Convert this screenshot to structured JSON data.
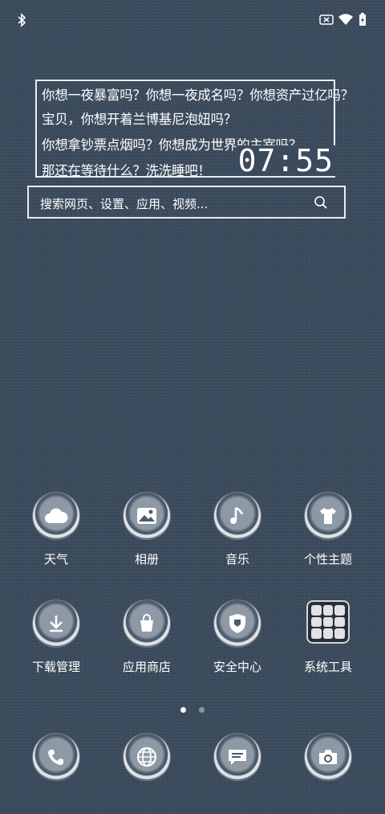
{
  "status_bar": {
    "bluetooth_icon": "bluetooth-icon",
    "sim_icon": "no-sim-icon",
    "wifi_icon": "wifi-icon",
    "battery_icon": "battery-charging-icon"
  },
  "quote_widget": {
    "lines": [
      "你想一夜暴富吗？你想一夜成名吗？你想资产过亿吗？",
      "宝贝，你想开着兰博基尼泡妞吗？",
      "你想拿钞票点烟吗？你想成为世界的主宰吗？",
      "那还在等待什么？洗洗睡吧！"
    ],
    "time": "07:55"
  },
  "search": {
    "placeholder": "搜索网页、设置、应用、视频..."
  },
  "apps_row1": [
    {
      "label": "天气",
      "icon": "cloud-icon"
    },
    {
      "label": "相册",
      "icon": "photo-icon"
    },
    {
      "label": "音乐",
      "icon": "music-note-icon"
    },
    {
      "label": "个性主题",
      "icon": "tshirt-icon"
    }
  ],
  "apps_row2": [
    {
      "label": "下载管理",
      "icon": "download-icon"
    },
    {
      "label": "应用商店",
      "icon": "shopping-bag-icon"
    },
    {
      "label": "安全中心",
      "icon": "shield-icon"
    },
    {
      "label": "系统工具",
      "icon": "tools-folder-icon"
    }
  ],
  "page_indicator": {
    "current": 1,
    "total": 2
  },
  "dock": [
    {
      "icon": "phone-icon"
    },
    {
      "icon": "browser-globe-icon"
    },
    {
      "icon": "message-icon"
    },
    {
      "icon": "camera-icon"
    }
  ]
}
